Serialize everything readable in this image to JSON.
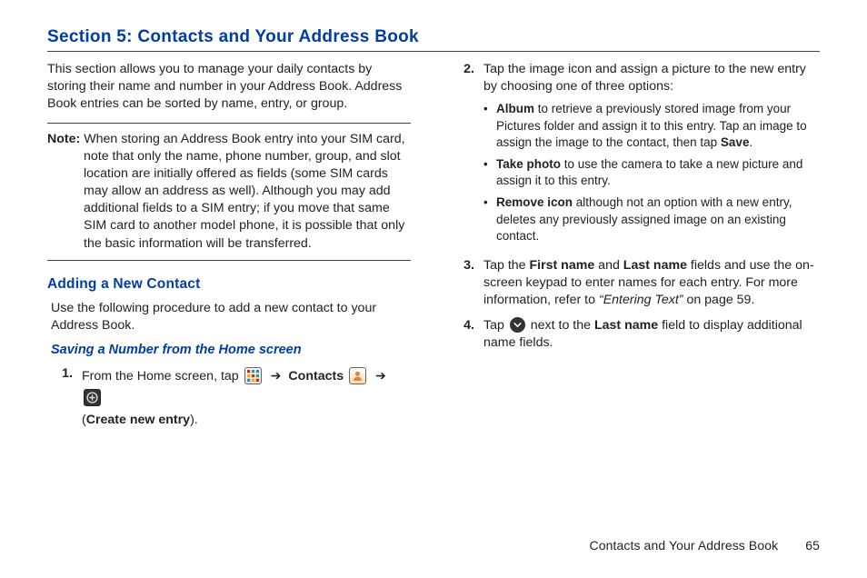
{
  "section": {
    "title": "Section 5: Contacts and Your Address Book"
  },
  "left": {
    "intro": "This section allows you to manage your daily contacts by storing their name and number in your Address Book. Address Book entries can be sorted by name, entry, or group.",
    "note_label": "Note:",
    "note_body": "When storing an Address Book entry into your SIM card, note that only the name, phone number, group, and slot location are initially offered as fields (some SIM cards may allow an address as well). Although you may add additional fields to a SIM entry; if you move that same SIM card to another model phone, it is possible that only the basic information will be transferred.",
    "add_heading": "Adding a New Contact",
    "add_intro": "Use the following procedure to add a new contact to your Address Book.",
    "save_heading": "Saving a Number from the Home screen",
    "step1": {
      "num": "1.",
      "prefix": "From the Home screen, tap ",
      "arrow": "➔",
      "contacts_label": "Contacts",
      "create_prefix": "(",
      "create_bold": "Create new entry",
      "create_suffix": ")."
    }
  },
  "right": {
    "step2": {
      "num": "2.",
      "text": "Tap the image icon and assign a picture to the new entry by choosing one of three options:",
      "bullets": {
        "b1": {
          "bold": "Album",
          "rest1": " to retrieve a previously stored image from your Pictures folder and assign it to this entry. Tap an image to assign the image to the contact, then tap ",
          "save": "Save",
          "rest2": "."
        },
        "b2": {
          "bold": "Take photo",
          "rest": " to use the camera to take a new picture and assign it to this entry."
        },
        "b3": {
          "bold": "Remove icon",
          "rest": " although not an option with a new entry, deletes any previously assigned image on an existing contact."
        }
      }
    },
    "step3": {
      "num": "3.",
      "p1": "Tap the ",
      "first_name": "First name",
      "and": " and ",
      "last_name": "Last name",
      "p2": " fields and use the on-screen keypad to enter names for each entry. For more information, refer to ",
      "ref": "“Entering Text”",
      "p3": "  on page 59."
    },
    "step4": {
      "num": "4.",
      "p1": "Tap ",
      "p2": " next to the ",
      "last_name": "Last name",
      "p3": " field to display additional name fields."
    }
  },
  "footer": {
    "label": "Contacts and Your Address Book",
    "page": "65"
  }
}
